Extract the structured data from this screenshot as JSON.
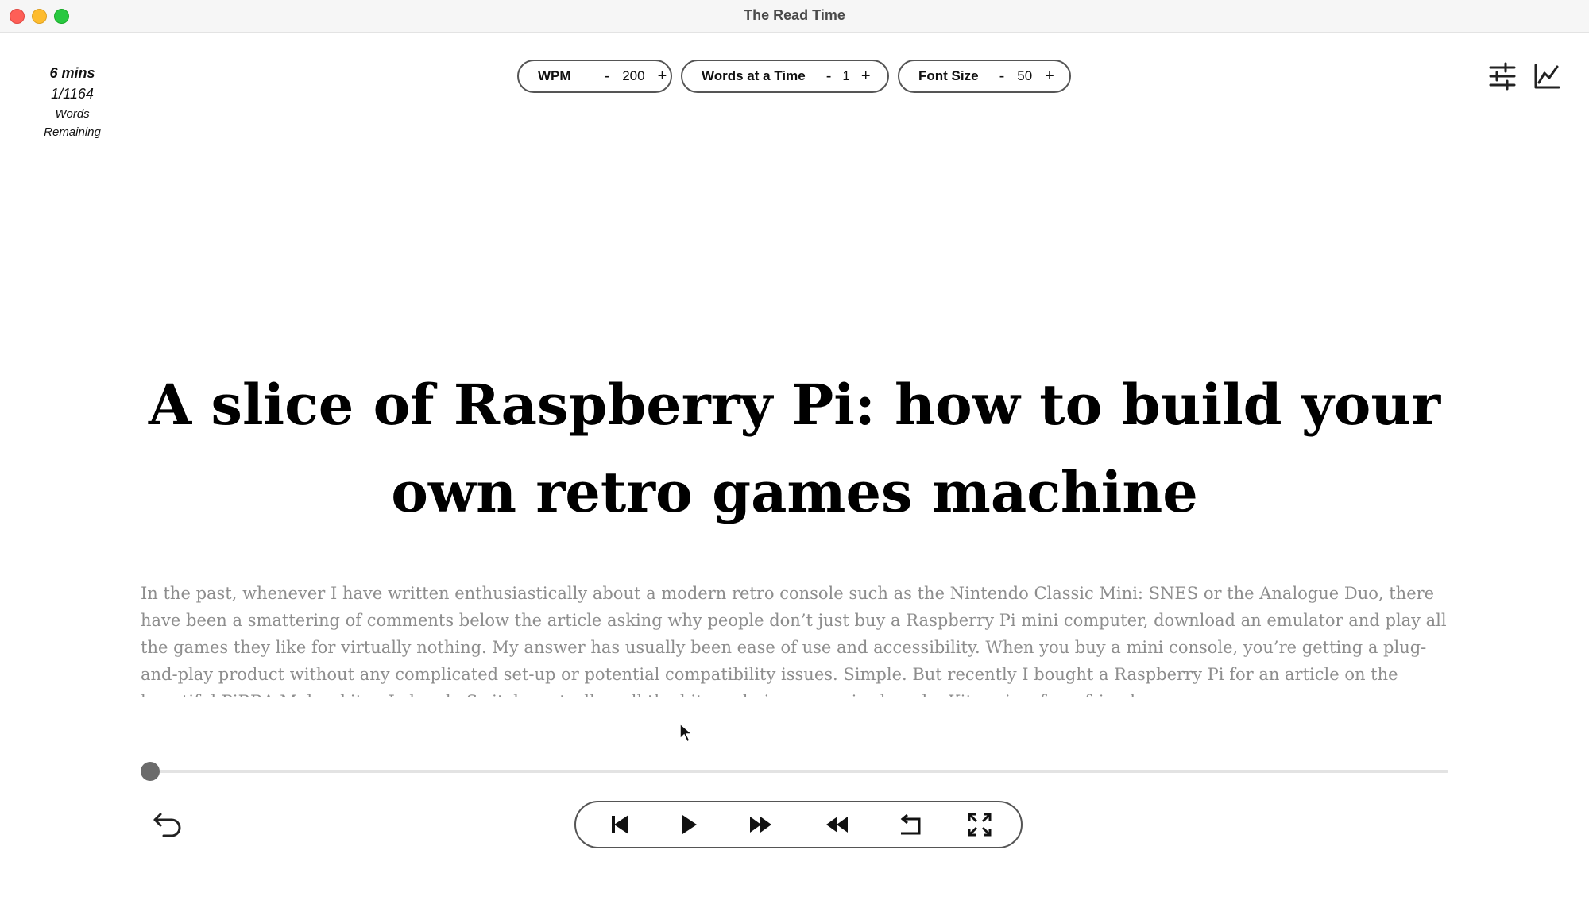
{
  "window": {
    "title": "The Read Time"
  },
  "stats": {
    "time_remaining": "6 mins",
    "word_progress": "1/1164",
    "label_line1": "Words",
    "label_line2": "Remaining"
  },
  "controls_top": {
    "wpm": {
      "label": "WPM",
      "value": "200",
      "minus": "-",
      "plus": "+"
    },
    "words_at_a_time": {
      "label": "Words at a Time",
      "value": "1",
      "minus": "-",
      "plus": "+"
    },
    "font_size": {
      "label": "Font Size",
      "value": "50",
      "minus": "-",
      "plus": "+"
    }
  },
  "toolbar_icons": {
    "settings": "sliders-icon",
    "stats": "line-chart-icon"
  },
  "reader": {
    "current_text": "A slice of Raspberry Pi: how to build your own retro games machine",
    "paragraph": "In the past, whenever I have written enthusiastically about a modern retro console such as the Nintendo Classic Mini: SNES or the Analogue Duo, there have been a smattering of comments below the article asking why people don’t just buy a Raspberry Pi mini computer, download an emulator and play all the games they like for virtually nothing. My answer has usually been ease of use and accessibility. When you buy a mini console, you’re getting a plug-and-play product without any complicated set-up or potential compatibility issues. Simple. But recently I bought a Raspberry Pi for an article on the beautiful PiBBA Maker kit, a Lokonda Switch controller, all the bits and pieces required, and a Kit review for a friend."
  },
  "progress": {
    "fraction": 0.0
  },
  "bottom_controls": {
    "undo": "undo-icon",
    "previous": "skip-back-icon",
    "play": "play-icon",
    "fast_forward": "fast-forward-icon",
    "rewind": "rewind-icon",
    "restart": "restart-icon",
    "fullscreen": "fullscreen-icon"
  },
  "colors": {
    "paragraph_text": "#8d8d8d",
    "slider_thumb": "#6b6b6b",
    "border": "#555555"
  }
}
